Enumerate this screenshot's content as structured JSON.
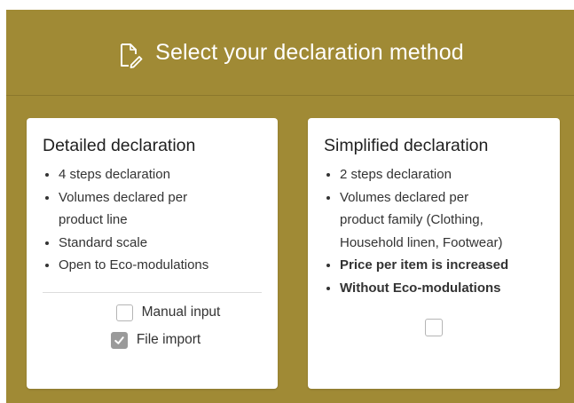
{
  "header": {
    "icon": "document-edit-icon",
    "title": "Select your declaration method"
  },
  "detailed": {
    "title": "Detailed declaration",
    "items": [
      "4 steps declaration",
      "Volumes declared per",
      "product line",
      "Standard scale",
      "Open to Eco-modulations"
    ],
    "options": {
      "manual_label": "Manual input",
      "manual_checked": false,
      "file_label": "File import",
      "file_checked": true
    }
  },
  "simplified": {
    "title": "Simplified declaration",
    "items": [
      "2 steps declaration",
      "Volumes declared per",
      "product family (Clothing,",
      "Household linen, Footwear)",
      "Price per item is increased",
      "Without Eco-modulations"
    ],
    "checked": false
  },
  "colors": {
    "panel": "#a08a35",
    "card": "#ffffff",
    "checkbox_checked": "#9a9a9a"
  }
}
